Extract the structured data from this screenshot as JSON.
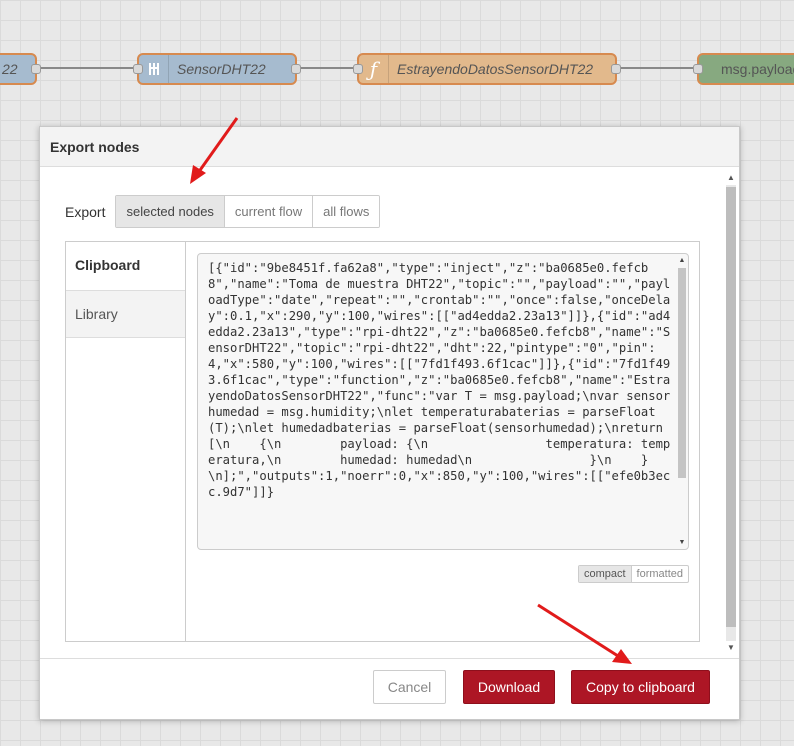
{
  "flow": {
    "nodes": [
      {
        "label": "22",
        "color": "#a6bbcf"
      },
      {
        "label": "SensorDHT22",
        "color": "#a6bbcf",
        "icon": "bridge-icon"
      },
      {
        "label": "EstrayendoDatosSensorDHT22",
        "color": "#e2b98c",
        "icon": "function-icon"
      },
      {
        "label": "msg.payload",
        "color": "#87a980"
      }
    ]
  },
  "dialog": {
    "title": "Export nodes",
    "export_label": "Export",
    "scope_options": [
      "selected nodes",
      "current flow",
      "all flows"
    ],
    "active_scope": "selected nodes",
    "tabs": [
      "Clipboard",
      "Library"
    ],
    "active_tab": "Clipboard",
    "code": "[{\"id\":\"9be8451f.fa62a8\",\"type\":\"inject\",\"z\":\"ba0685e0.fefcb8\",\"name\":\"Toma de muestra DHT22\",\"topic\":\"\",\"payload\":\"\",\"payloadType\":\"date\",\"repeat\":\"\",\"crontab\":\"\",\"once\":false,\"onceDelay\":0.1,\"x\":290,\"y\":100,\"wires\":[[\"ad4edda2.23a13\"]]},{\"id\":\"ad4edda2.23a13\",\"type\":\"rpi-dht22\",\"z\":\"ba0685e0.fefcb8\",\"name\":\"SensorDHT22\",\"topic\":\"rpi-dht22\",\"dht\":22,\"pintype\":\"0\",\"pin\":4,\"x\":580,\"y\":100,\"wires\":[[\"7fd1f493.6f1cac\"]]},{\"id\":\"7fd1f493.6f1cac\",\"type\":\"function\",\"z\":\"ba0685e0.fefcb8\",\"name\":\"EstrayendoDatosSensorDHT22\",\"func\":\"var T = msg.payload;\\nvar sensorhumedad = msg.humidity;\\nlet temperaturabaterias = parseFloat(T);\\nlet humedadbaterias = parseFloat(sensorhumedad);\\nreturn [\\n    {\\n        payload: {\\n                temperatura: temperatura,\\n        humedad: humedad\\n                }\\n    }\\n];\",\"outputs\":1,\"noerr\":0,\"x\":850,\"y\":100,\"wires\":[[\"efe0b3ecc.9d7\"]]}",
    "format_options": [
      "compact",
      "formatted"
    ],
    "active_format": "compact",
    "buttons": {
      "cancel": "Cancel",
      "download": "Download",
      "copy": "Copy to clipboard"
    }
  },
  "colors": {
    "primary": "#ad1625",
    "annotation": "#e11b1b"
  }
}
